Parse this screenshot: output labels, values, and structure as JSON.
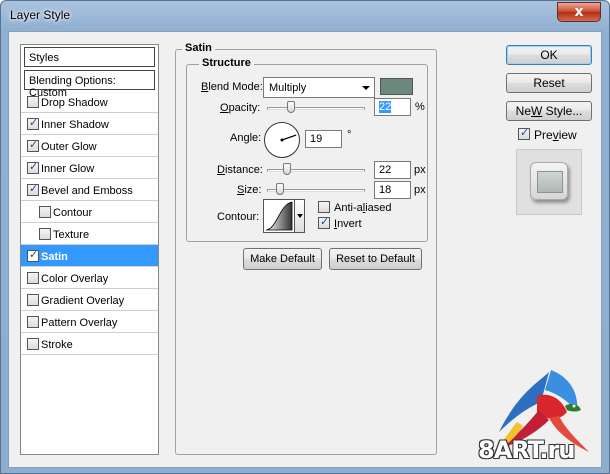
{
  "window": {
    "title": "Layer Style",
    "close_glyph": "x"
  },
  "styles_list": {
    "header": "Styles",
    "blending_options": "Blending Options: Custom",
    "items": [
      {
        "label": "Drop Shadow",
        "checked": false,
        "sub": false,
        "selected": false
      },
      {
        "label": "Inner Shadow",
        "checked": true,
        "sub": false,
        "selected": false
      },
      {
        "label": "Outer Glow",
        "checked": true,
        "sub": false,
        "selected": false
      },
      {
        "label": "Inner Glow",
        "checked": true,
        "sub": false,
        "selected": false
      },
      {
        "label": "Bevel and Emboss",
        "checked": true,
        "sub": false,
        "selected": false
      },
      {
        "label": "Contour",
        "checked": false,
        "sub": true,
        "selected": false
      },
      {
        "label": "Texture",
        "checked": false,
        "sub": true,
        "selected": false
      },
      {
        "label": "Satin",
        "checked": true,
        "sub": false,
        "selected": true
      },
      {
        "label": "Color Overlay",
        "checked": false,
        "sub": false,
        "selected": false
      },
      {
        "label": "Gradient Overlay",
        "checked": false,
        "sub": false,
        "selected": false
      },
      {
        "label": "Pattern Overlay",
        "checked": false,
        "sub": false,
        "selected": false
      },
      {
        "label": "Stroke",
        "checked": false,
        "sub": false,
        "selected": false
      }
    ]
  },
  "satin": {
    "group_title": "Satin",
    "structure_title": "Structure",
    "blend_mode": {
      "label_u": "B",
      "label_rest": "lend Mode:",
      "value": "Multiply",
      "color": "#6b8a7d"
    },
    "opacity": {
      "label_u": "O",
      "label_rest": "pacity:",
      "value": "22",
      "unit": "%",
      "percent": 22
    },
    "angle": {
      "label_pre": "An",
      "label_u": "g",
      "label_rest": "le:",
      "value": "19",
      "unit": "°",
      "degrees": 19
    },
    "distance": {
      "label_u": "D",
      "label_rest": "istance:",
      "value": "22",
      "unit": "px",
      "percent": 18
    },
    "size": {
      "label_u": "S",
      "label_rest": "ize:",
      "value": "18",
      "unit": "px",
      "percent": 10
    },
    "contour": {
      "label": "Contour:"
    },
    "anti_aliased": {
      "label_pre": "Anti-a",
      "label_u": "l",
      "label_rest": "iased",
      "checked": false
    },
    "invert": {
      "label_u": "I",
      "label_rest": "nvert",
      "checked": true
    }
  },
  "buttons": {
    "make_default": "Make Default",
    "reset_to_default": "Reset to Default",
    "ok": "OK",
    "reset": "Reset",
    "new_style_u": "W",
    "new_style_pre": "Ne",
    "new_style_rest": " Style...",
    "preview_u": "v",
    "preview_pre": "Pre",
    "preview_rest": "iew",
    "preview_checked": true
  },
  "watermark": {
    "text": "8ART.ru"
  }
}
